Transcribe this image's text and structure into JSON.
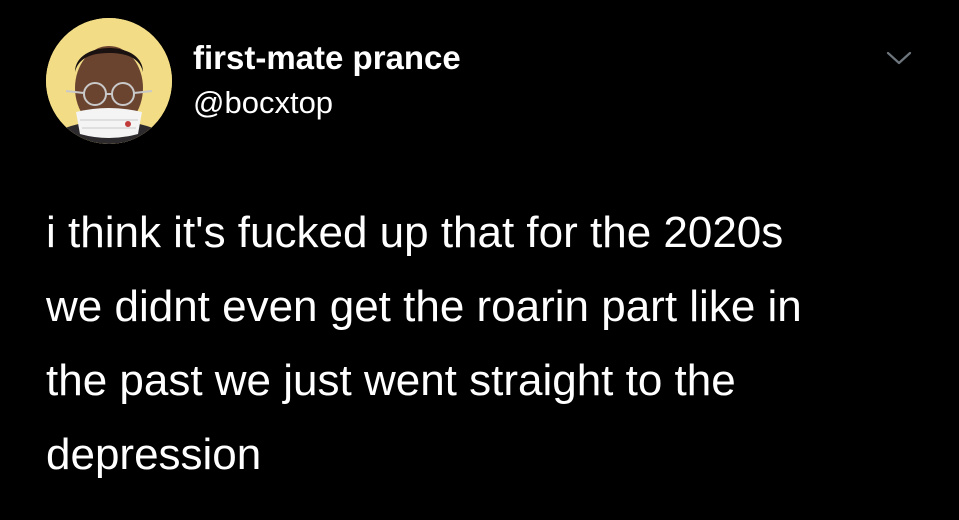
{
  "tweet": {
    "author": {
      "display_name": "first-mate prance",
      "handle": "@bocxtop",
      "avatar_icon": "profile-avatar"
    },
    "menu_icon": "chevron-down-icon",
    "text_lines": [
      "i think it's fucked up that for the 2020s",
      "we didnt even get the roarin part like in",
      "the past we just went straight to the",
      "depression"
    ]
  },
  "colors": {
    "background": "#000000",
    "text": "#ffffff",
    "avatar_background": "#f2dc86",
    "caret": "#6e767d"
  }
}
